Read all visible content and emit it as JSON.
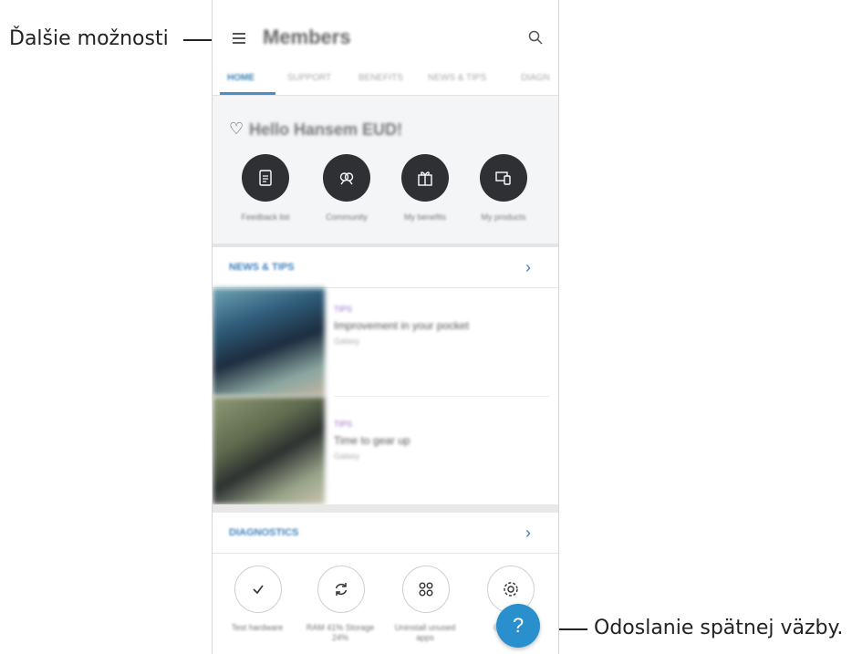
{
  "callouts": {
    "more_options": "Ďalšie možnosti",
    "send_feedback": "Odoslanie spätnej väzby."
  },
  "app": {
    "title": "Members",
    "tabs": [
      "HOME",
      "SUPPORT",
      "BENEFITS",
      "NEWS & TIPS",
      "DIAGN"
    ],
    "active_tab": "HOME"
  },
  "greeting": {
    "text": "Hello Hansem EUD!",
    "actions": [
      {
        "label": "Feedback list",
        "icon": "document-icon"
      },
      {
        "label": "Community",
        "icon": "community-icon"
      },
      {
        "label": "My benefits",
        "icon": "gift-icon"
      },
      {
        "label": "My products",
        "icon": "devices-icon"
      }
    ]
  },
  "news_section": {
    "title": "NEWS & TIPS",
    "items": [
      {
        "tag": "TIPS",
        "title": "Improvement in your pocket",
        "sub": "Galaxy"
      },
      {
        "tag": "TIPS",
        "title": "Time to gear up",
        "sub": "Galaxy"
      }
    ]
  },
  "diagnostics_section": {
    "title": "DIAGNOSTICS",
    "actions": [
      {
        "label": "Test hardware",
        "icon": "check-icon"
      },
      {
        "label": "RAM 41% Storage 24%",
        "icon": "refresh-icon"
      },
      {
        "label": "Uninstall unused apps",
        "icon": "apps-icon"
      },
      {
        "label": "Optimize",
        "icon": "settings-icon"
      }
    ]
  },
  "fab": {
    "label": "?"
  },
  "colors": {
    "accent": "#3f7fbd",
    "fab": "#2a8fcd",
    "dark_circle": "#2e3034",
    "tag": "#9a6ec8"
  }
}
